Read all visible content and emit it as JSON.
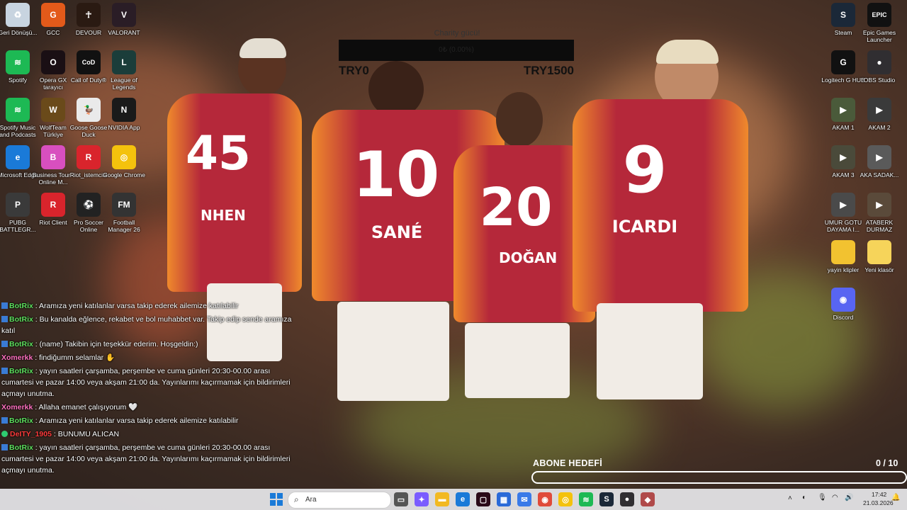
{
  "desktop": {
    "left_icons": [
      {
        "label": "Geri Dönüşü...",
        "icon": "recycle-bin-icon",
        "color": "#c8d4e0",
        "glyph": "♻"
      },
      {
        "label": "GCC",
        "icon": "gcc-icon",
        "color": "#e35a1a",
        "glyph": "G"
      },
      {
        "label": "DEVOUR",
        "icon": "devour-icon",
        "color": "#2a1a12",
        "glyph": "☥"
      },
      {
        "label": "VALORANT",
        "icon": "valorant-icon",
        "color": "#2a1d26",
        "glyph": "V"
      },
      {
        "label": "Spotify",
        "icon": "spotify-icon",
        "color": "#1db954",
        "glyph": "≋"
      },
      {
        "label": "Opera GX tarayıcı",
        "icon": "opera-gx-icon",
        "color": "#1a0f14",
        "glyph": "O"
      },
      {
        "label": "Call of Duty®",
        "icon": "call-of-duty-icon",
        "color": "#111111",
        "glyph": "CoD"
      },
      {
        "label": "League of Legends",
        "icon": "league-of-legends-icon",
        "color": "#1b3d3a",
        "glyph": "L"
      },
      {
        "label": "Spotify Music and Podcasts",
        "icon": "spotify-icon",
        "color": "#1db954",
        "glyph": "≋"
      },
      {
        "label": "WolfTeam Türkiye",
        "icon": "wolfteam-icon",
        "color": "#6a4a1a",
        "glyph": "W"
      },
      {
        "label": "Goose Goose Duck",
        "icon": "goose-goose-duck-icon",
        "color": "#eaeaea",
        "glyph": "🦆"
      },
      {
        "label": "NVIDIA App",
        "icon": "nvidia-icon",
        "color": "#1a1a1a",
        "glyph": "N"
      },
      {
        "label": "Microsoft Edge",
        "icon": "edge-icon",
        "color": "#1a7ad8",
        "glyph": "e"
      },
      {
        "label": "Business Tour - Online M...",
        "icon": "business-tour-icon",
        "color": "#d84fbf",
        "glyph": "B"
      },
      {
        "label": "Riot_istemcisi",
        "icon": "riot-client-icon",
        "color": "#d9242c",
        "glyph": "R"
      },
      {
        "label": "Google Chrome",
        "icon": "chrome-icon",
        "color": "#f4c20d",
        "glyph": "◎"
      },
      {
        "label": "PUBG BATTLEGR...",
        "icon": "pubg-icon",
        "color": "#3a3a3a",
        "glyph": "P"
      },
      {
        "label": "Riot Client",
        "icon": "riot-client-icon",
        "color": "#d9242c",
        "glyph": "R"
      },
      {
        "label": "Pro Soccer Online",
        "icon": "pro-soccer-icon",
        "color": "#222222",
        "glyph": "⚽"
      },
      {
        "label": "Football Manager 26",
        "icon": "football-manager-icon",
        "color": "#333333",
        "glyph": "FM"
      }
    ],
    "right_icons": [
      {
        "label": "Steam",
        "icon": "steam-icon",
        "color": "#1b2838",
        "glyph": "S"
      },
      {
        "label": "Epic Games Launcher",
        "icon": "epic-games-icon",
        "color": "#111111",
        "glyph": "EPIC"
      },
      {
        "label": "Logitech G HUB",
        "icon": "logitech-icon",
        "color": "#111111",
        "glyph": "G"
      },
      {
        "label": "OBS Studio",
        "icon": "obs-icon",
        "color": "#302e31",
        "glyph": "●"
      },
      {
        "label": "AKAM 1",
        "icon": "video-file-icon",
        "color": "#4a5a3a",
        "glyph": "▶"
      },
      {
        "label": "AKAM 2",
        "icon": "video-file-icon",
        "color": "#3a3a3a",
        "glyph": "▶"
      },
      {
        "label": "AKAM 3",
        "icon": "video-file-icon",
        "color": "#4a4a3a",
        "glyph": "▶"
      },
      {
        "label": "AKA SADAK...",
        "icon": "video-file-icon",
        "color": "#5a5a5a",
        "glyph": "▶"
      },
      {
        "label": "UMUR GOTU DAYAMA I...",
        "icon": "video-file-icon",
        "color": "#4a4a4a",
        "glyph": "▶"
      },
      {
        "label": "ATABERK DURMAZ",
        "icon": "video-file-icon",
        "color": "#5a4a3a",
        "glyph": "▶"
      },
      {
        "label": "yayin klipler",
        "icon": "folder-icon",
        "color": "#f2c230",
        "glyph": ""
      },
      {
        "label": "Yeni klasör",
        "icon": "folder-icon",
        "color": "#f6d45a",
        "glyph": ""
      },
      {
        "label": "Discord",
        "icon": "discord-icon",
        "color": "#5865f2",
        "glyph": "◉"
      }
    ]
  },
  "goal": {
    "title": "Charity gücü!",
    "value_text": "0₺ (0.00%)",
    "progress": 0,
    "min": "TRY0",
    "max": "TRY1500"
  },
  "chat": [
    {
      "user": "BotRix",
      "type": "bot",
      "color": "#5ee05e",
      "text": "Aramıza yeni katılanlar varsa takip ederek ailemize katılabilir"
    },
    {
      "user": "BotRix",
      "type": "bot",
      "color": "#5ee05e",
      "text": "Bu kanalda eğlence, rekabet ve bol muhabbet var. Takip edip sende aramıza katıl"
    },
    {
      "user": "BotRix",
      "type": "bot",
      "color": "#5ee05e",
      "text": "(name) Takibin için teşekkür ederim. Hoşgeldin:)"
    },
    {
      "user": "Xomerkk",
      "type": "user",
      "color": "#ff70c0",
      "text": "findiğumm selamlar ✋"
    },
    {
      "user": "BotRix",
      "type": "bot",
      "color": "#5ee05e",
      "text": "yayın saatleri çarşamba, perşembe ve cuma günleri 20:30-00.00 arası cumartesi ve pazar 14:00 veya akşam 21:00 da. Yayınlarımı kaçırmamak için bildirimleri açmayı unutma."
    },
    {
      "user": "Xomerkk",
      "type": "user",
      "color": "#ff70c0",
      "text": "Allaha emanet çalışıyorum 🤍"
    },
    {
      "user": "BotRix",
      "type": "bot",
      "color": "#5ee05e",
      "text": "Aramıza yeni katılanlar varsa takip ederek ailemize katılabilir"
    },
    {
      "user": "DeITY_1905",
      "type": "mod",
      "color": "#ff3b3b",
      "text": "BUNUMU ALICAN"
    },
    {
      "user": "BotRix",
      "type": "bot",
      "color": "#5ee05e",
      "text": "yayın saatleri çarşamba, perşembe ve cuma günleri 20:30-00.00 arası cumartesi ve pazar 14:00 veya akşam 21:00 da. Yayınlarımı kaçırmamak için bildirimleri açmayı unutma."
    }
  ],
  "sub_goal": {
    "title": "ABONE HEDEFİ",
    "count": "0 / 10",
    "progress": 0
  },
  "players": [
    {
      "number": "45",
      "name": "NHEN"
    },
    {
      "number": "10",
      "name": "SANÉ"
    },
    {
      "number": "20",
      "name": "DOĞAN"
    },
    {
      "number": "9",
      "name": "ICARDI"
    }
  ],
  "taskbar": {
    "search_placeholder": "Ara",
    "apps": [
      {
        "icon": "task-view-icon",
        "color": "#555555",
        "glyph": "▭"
      },
      {
        "icon": "copilot-icon",
        "color": "#7a5cff",
        "glyph": "✦"
      },
      {
        "icon": "file-explorer-icon",
        "color": "#f2b922",
        "glyph": "▬"
      },
      {
        "icon": "edge-icon",
        "color": "#1a7ad8",
        "glyph": "e"
      },
      {
        "icon": "terminal-icon",
        "color": "#2a0a18",
        "glyph": "▢"
      },
      {
        "icon": "store-icon",
        "color": "#2a6ad8",
        "glyph": "▦"
      },
      {
        "icon": "mail-icon",
        "color": "#3a7ae8",
        "glyph": "✉"
      },
      {
        "icon": "chrome-icon",
        "color": "#e04a3a",
        "glyph": "◉"
      },
      {
        "icon": "chrome-icon",
        "color": "#f4c20d",
        "glyph": "◎"
      },
      {
        "icon": "spotify-icon",
        "color": "#1db954",
        "glyph": "≋"
      },
      {
        "icon": "steam-icon",
        "color": "#1b2838",
        "glyph": "S"
      },
      {
        "icon": "obs-icon",
        "color": "#302e31",
        "glyph": "●"
      },
      {
        "icon": "game-icon",
        "color": "#b04a4a",
        "glyph": "◆"
      }
    ],
    "time": "17:42",
    "date": "21.03.2026"
  }
}
